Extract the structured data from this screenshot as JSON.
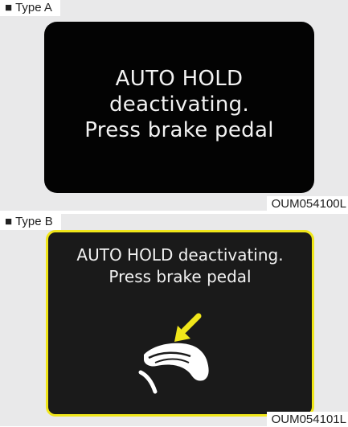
{
  "type_a": {
    "label_bullet": "■",
    "label": "Type A",
    "message_line1": "AUTO HOLD",
    "message_line2": "deactivating.",
    "message_line3": "Press brake pedal",
    "code": "OUM054100L"
  },
  "type_b": {
    "label_bullet": "■",
    "label": "Type B",
    "message_line1": "AUTO HOLD deactivating.",
    "message_line2": "Press brake pedal",
    "icon": "foot-on-brake-pedal-icon",
    "code": "OUM054101L"
  },
  "colors": {
    "screen_a_background": "#030303",
    "screen_b_background": "#1a1a1a",
    "screen_b_border": "#f0e61a",
    "arrow_accent": "#f0e61a",
    "display_text": "#f2f2f2",
    "panel_background": "#e9e9ea"
  }
}
